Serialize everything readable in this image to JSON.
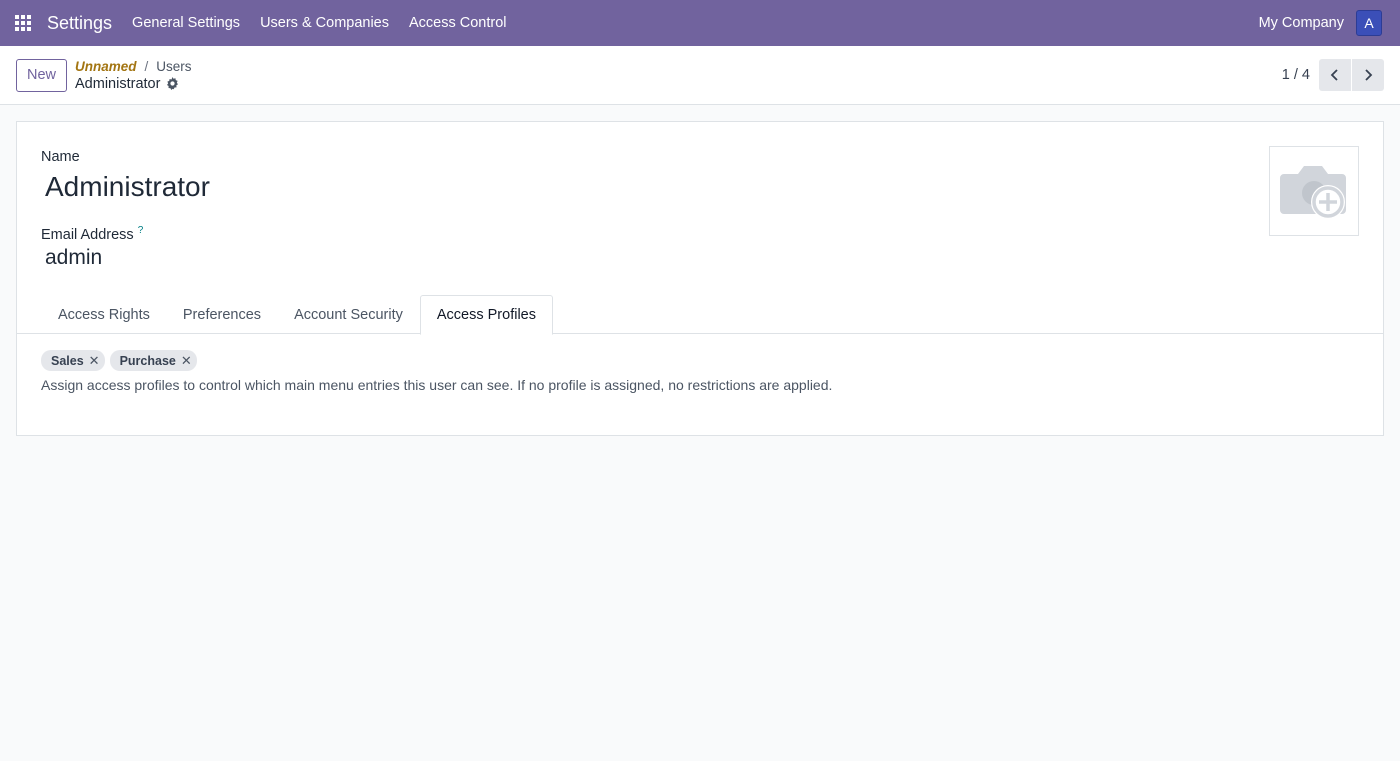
{
  "navbar": {
    "app_title": "Settings",
    "menu": [
      "General Settings",
      "Users & Companies",
      "Access Control"
    ],
    "company": "My Company",
    "avatar_initial": "A",
    "color": "#71639e"
  },
  "control_panel": {
    "new_label": "New",
    "breadcrumb": {
      "parent_italic": "Unnamed",
      "separator": "/",
      "parent": "Users",
      "current": "Administrator"
    },
    "pager": {
      "value": "1 / 4"
    }
  },
  "form": {
    "name_label": "Name",
    "name_value": "Administrator",
    "email_label": "Email Address",
    "email_help": "?",
    "email_value": "admin",
    "photo_icon": "camera-plus-icon"
  },
  "tabs": [
    {
      "label": "Access Rights",
      "active": false
    },
    {
      "label": "Preferences",
      "active": false
    },
    {
      "label": "Account Security",
      "active": false
    },
    {
      "label": "Access Profiles",
      "active": true
    }
  ],
  "access_profiles": {
    "tags": [
      "Sales",
      "Purchase"
    ],
    "remove_glyph": "✕",
    "help_text": "Assign access profiles to control which main menu entries this user can see. If no profile is assigned, no restrictions are applied."
  }
}
